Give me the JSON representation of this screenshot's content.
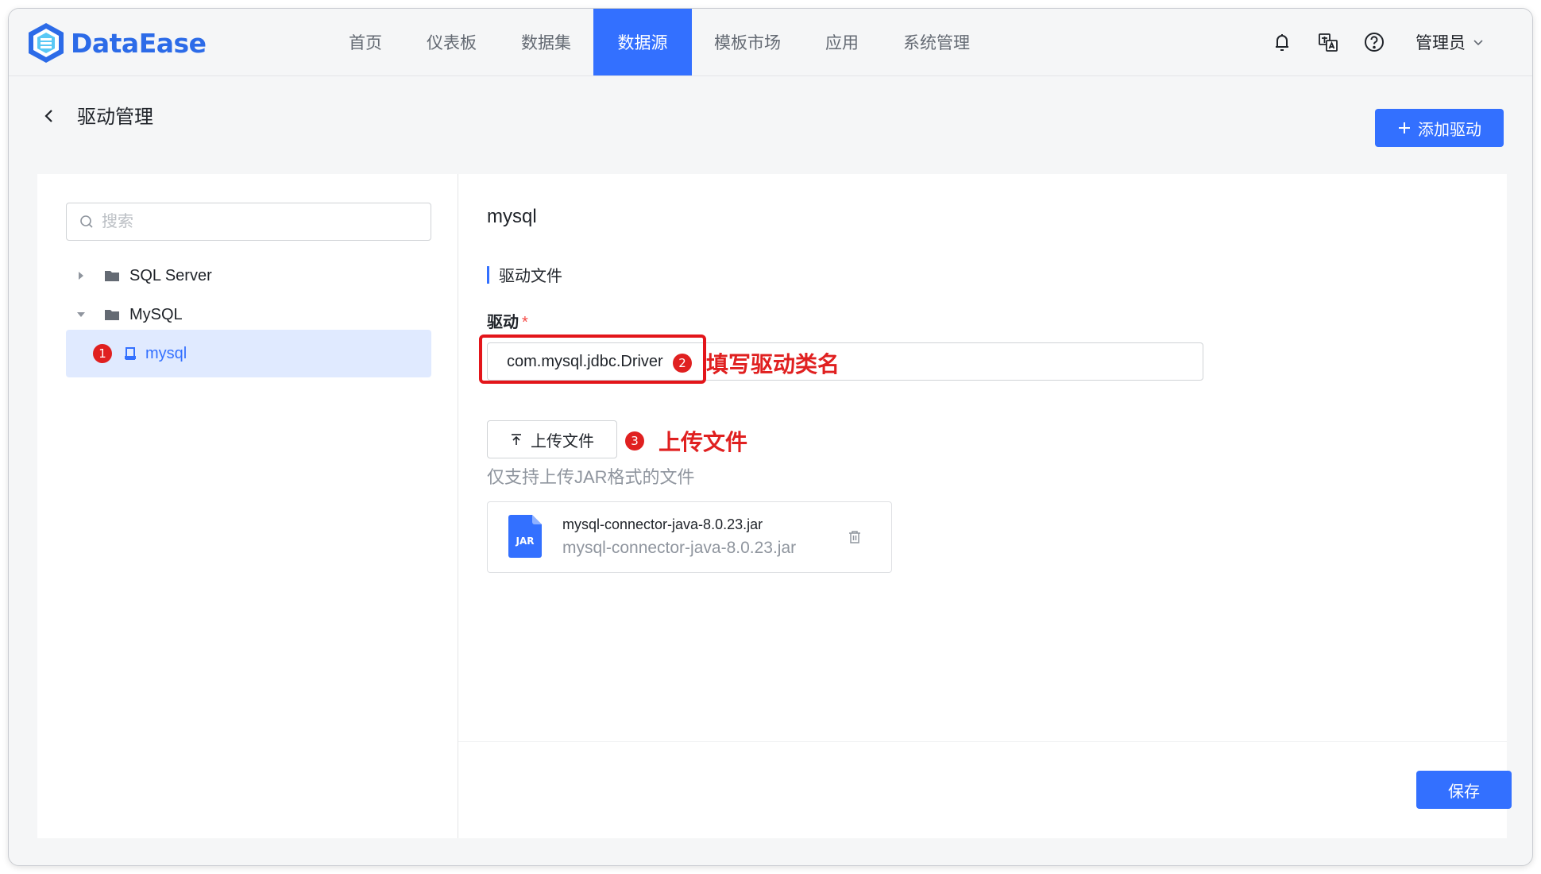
{
  "app": {
    "name": "DataEase"
  },
  "nav": {
    "items": [
      {
        "label": "首页"
      },
      {
        "label": "仪表板"
      },
      {
        "label": "数据集"
      },
      {
        "label": "数据源"
      },
      {
        "label": "模板市场"
      },
      {
        "label": "应用"
      },
      {
        "label": "系统管理"
      }
    ],
    "active": "数据源",
    "user": "管理员",
    "icons": [
      "bell-icon",
      "translate-icon",
      "help-icon"
    ]
  },
  "header": {
    "title": "驱动管理",
    "add_button": "添加驱动"
  },
  "sidebar": {
    "search_placeholder": "搜索",
    "tree": [
      {
        "label": "SQL Server",
        "expanded": false
      },
      {
        "label": "MySQL",
        "expanded": true
      },
      {
        "label": "mysql",
        "selected": true
      }
    ],
    "badge": "1"
  },
  "detail": {
    "name": "mysql",
    "section_title": "驱动文件",
    "driver_label": "驱动",
    "required_mark": "*",
    "driver_value": "com.mysql.jdbc.Driver",
    "upload_button": "上传文件",
    "hint": "仅支持上传JAR格式的文件",
    "file": {
      "icon_text": "JAR",
      "name": "mysql-connector-java-8.0.23.jar",
      "subtitle": "mysql-connector-java-8.0.23.jar"
    },
    "save_button": "保存"
  },
  "annotations": {
    "step2_badge": "2",
    "step2_text": "填写驱动类名",
    "step3_badge": "3",
    "step3_text": "上传文件"
  },
  "colors": {
    "primary": "#3370ff",
    "annotation_red": "#e02020",
    "selected_bg": "#e0eaff"
  }
}
